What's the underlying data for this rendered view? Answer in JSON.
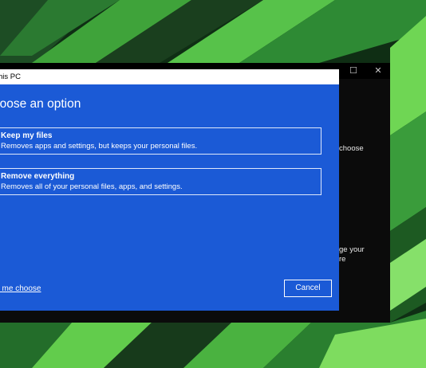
{
  "background_window": {
    "peek_text_1": "choose",
    "peek_text_2": "ge your",
    "peek_text_3": "re",
    "maximize_glyph": "☐",
    "close_glyph": "✕"
  },
  "dialog": {
    "title": "his PC",
    "heading": "hoose an option",
    "options": [
      {
        "title": "Keep my files",
        "description": "Removes apps and settings, but keeps your personal files."
      },
      {
        "title": "Remove everything",
        "description": "Removes all of your personal files, apps, and settings."
      }
    ],
    "help_link": "lp me choose",
    "cancel_label": "Cancel"
  },
  "colors": {
    "dialog_background": "#1b5ad6",
    "wallpaper_green": "#5fd24a",
    "background_window": "#0b0b0b"
  }
}
